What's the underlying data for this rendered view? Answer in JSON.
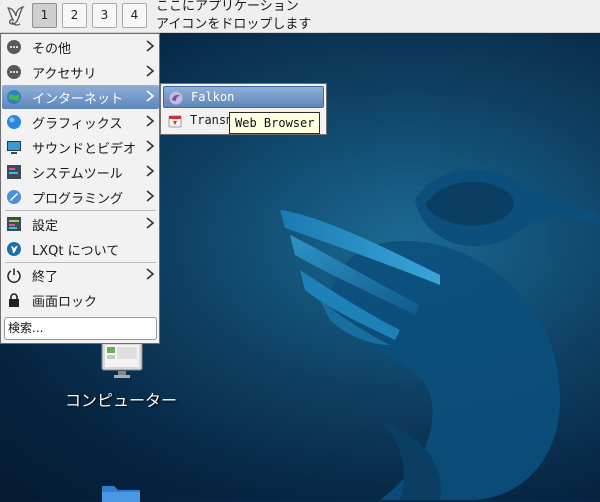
{
  "panel": {
    "desktops": [
      "1",
      "2",
      "3",
      "4"
    ],
    "active_desktop": "1",
    "quicklaunch_hint": [
      "ここにアプリケーション",
      "アイコンをドロップします"
    ]
  },
  "menu": {
    "items": [
      {
        "label": "その他",
        "icon": "other-icon",
        "submenu": true
      },
      {
        "label": "アクセサリ",
        "icon": "accessories-icon",
        "submenu": true
      },
      {
        "label": "インターネット",
        "icon": "internet-icon",
        "submenu": true,
        "highlighted": true
      },
      {
        "label": "グラフィックス",
        "icon": "graphics-icon",
        "submenu": true
      },
      {
        "label": "サウンドとビデオ",
        "icon": "sound-video-icon",
        "submenu": true
      },
      {
        "label": "システムツール",
        "icon": "system-tools-icon",
        "submenu": true
      },
      {
        "label": "プログラミング",
        "icon": "programming-icon",
        "submenu": true
      },
      {
        "label": "設定",
        "icon": "settings-icon",
        "submenu": true
      },
      {
        "label": "LXQt について",
        "icon": "lxqt-about-icon",
        "submenu": false
      },
      {
        "label": "終了",
        "icon": "power-icon",
        "submenu": true
      },
      {
        "label": "画面ロック",
        "icon": "lock-icon",
        "submenu": false
      }
    ],
    "search_value": "検索..."
  },
  "submenu": {
    "items": [
      {
        "label": "Falkon",
        "icon": "falkon-icon",
        "highlighted": true
      },
      {
        "label": "Transm",
        "icon": "transmission-icon"
      }
    ]
  },
  "tooltip": {
    "text": "Web Browser"
  },
  "desktop": {
    "computer_label": "コンピューター"
  },
  "colors": {
    "highlight": "#5d86bb",
    "panel": "#efefef",
    "desktop": "#0e3f63"
  }
}
